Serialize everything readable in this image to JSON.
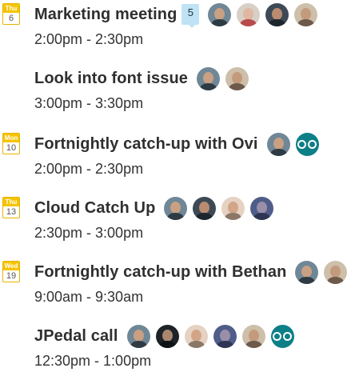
{
  "events": [
    {
      "title": "Marketing meeting",
      "time": "2:00pm - 2:30pm",
      "date": {
        "dow": "Thu",
        "day": "6"
      },
      "count": "5"
    },
    {
      "title": "Look into font issue",
      "time": "3:00pm - 3:30pm"
    },
    {
      "title": "Fortnightly catch-up with Ovi",
      "time": "2:00pm - 2:30pm",
      "date": {
        "dow": "Mon",
        "day": "10"
      }
    },
    {
      "title": "Cloud Catch Up",
      "time": "2:30pm - 3:00pm",
      "date": {
        "dow": "Thu",
        "day": "13"
      }
    },
    {
      "title": "Fortnightly catch-up with Bethan",
      "time": "9:00am - 9:30am",
      "date": {
        "dow": "Wed",
        "day": "19"
      }
    },
    {
      "title": "JPedal call",
      "time": "12:30pm - 1:00pm"
    }
  ],
  "colors": {
    "date_badge": "#f5c400",
    "count_badge": "#bfe3f4",
    "room_icon": "#0d7f86"
  }
}
